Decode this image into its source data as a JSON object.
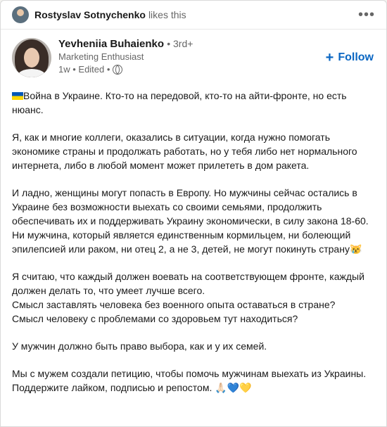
{
  "activity": {
    "actor": "Rostyslav Sotnychenko",
    "action": "likes this",
    "more": "•••"
  },
  "post": {
    "author": "Yevheniia Buhaienko",
    "degree": "• 3rd+",
    "headline": "Marketing Enthusiast",
    "time": "1w • Edited •",
    "follow_label": "Follow",
    "paragraphs": [
      "Война в Украине. Кто-то на передовой, кто-то на айти-фронте, но есть нюанс.",
      "Я, как и многие коллеги, оказались в ситуации, когда нужно помогать экономике страны и продолжать работать, но у тебя либо нет нормального интернета, либо в любой момент может прилететь в дом ракета.",
      "И ладно, женщины могут попасть в Европу. Но мужчины сейчас остались в Украине без возможности выехать со своими семьями, продолжить обеспечивать их и поддерживать Украину экономически, в силу закона 18-60. Ни мужчина, который является единственным кормильцем, ни болеющий эпилепсией или раком, ни отец 2, а не 3, детей, не могут покинуть страну😿",
      "Я считаю, что каждый должен воевать на соответствующем фронте, каждый должен делать то, что умеет лучше всего.\nСмысл заставлять человека без военного опыта оставаться в стране?\nСмысл человеку с проблемами со здоровьем тут находиться?",
      "У мужчин должно быть право выбора, как и у их семей.",
      "Мы с мужем создали петицию, чтобы помочь мужчинам выехать из Украины. Поддержите лайком, подписью и репостом. 🙏🏻💙💛"
    ]
  },
  "colors": {
    "link": "#0a66c2",
    "secondary_text": "#666666"
  },
  "icons": {
    "flag": "ukraine-flag-icon",
    "visibility": "globe-icon"
  }
}
